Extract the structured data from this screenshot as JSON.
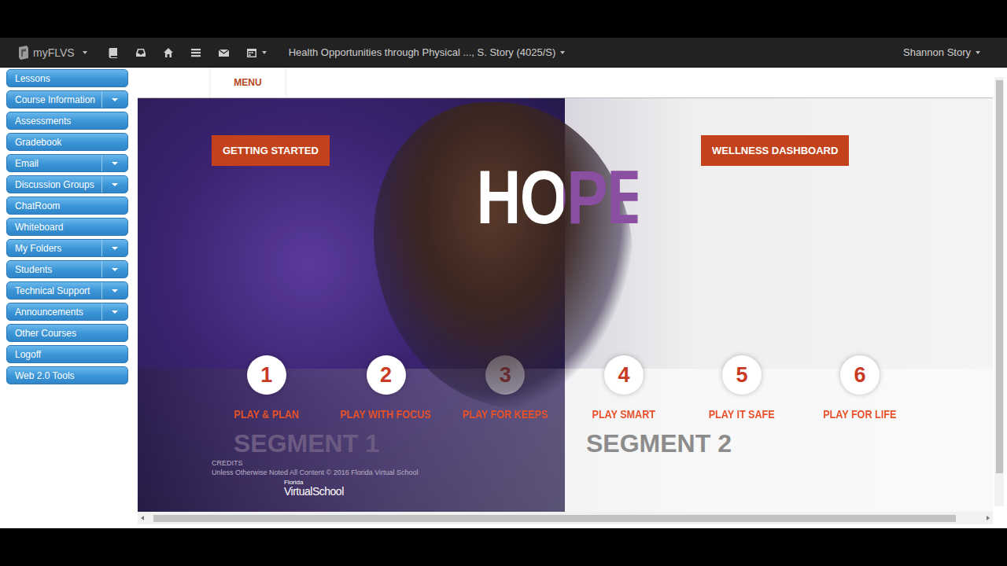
{
  "nav": {
    "logo": "myFLVS",
    "course": "Health Opportunities through Physical ..., S. Story (4025/S)",
    "user": "Shannon Story"
  },
  "sidebar": {
    "items": [
      {
        "label": "Lessons",
        "has_menu": false
      },
      {
        "label": "Course Information",
        "has_menu": true
      },
      {
        "label": "Assessments",
        "has_menu": false
      },
      {
        "label": "Gradebook",
        "has_menu": false
      },
      {
        "label": "Email",
        "has_menu": true
      },
      {
        "label": "Discussion Groups",
        "has_menu": true
      },
      {
        "label": "ChatRoom",
        "has_menu": false
      },
      {
        "label": "Whiteboard",
        "has_menu": false
      },
      {
        "label": "My Folders",
        "has_menu": true
      },
      {
        "label": "Students",
        "has_menu": true
      },
      {
        "label": "Technical Support",
        "has_menu": true
      },
      {
        "label": "Announcements",
        "has_menu": true
      },
      {
        "label": "Other Courses",
        "has_menu": false
      },
      {
        "label": "Logoff",
        "has_menu": false
      },
      {
        "label": "Web 2.0 Tools",
        "has_menu": false
      }
    ]
  },
  "menu_tab": "MENU",
  "hero": {
    "title": "HOPE",
    "segments": [
      {
        "label": "SEGMENT 1",
        "button": "GETTING STARTED",
        "units": [
          {
            "number": "1",
            "label": "PLAY & PLAN"
          },
          {
            "number": "2",
            "label": "PLAY WITH FOCUS"
          },
          {
            "number": "3",
            "label": "PLAY FOR KEEPS"
          }
        ]
      },
      {
        "label": "SEGMENT 2",
        "button": "WELLNESS DASHBOARD",
        "units": [
          {
            "number": "4",
            "label": "PLAY SMART"
          },
          {
            "number": "5",
            "label": "PLAY IT SAFE"
          },
          {
            "number": "6",
            "label": "PLAY FOR LIFE"
          }
        ]
      }
    ],
    "credits": {
      "heading": "CREDITS",
      "text": "Unless Otherwise Noted All Content © 2016 Florida Virtual School",
      "logo_top": "Florida",
      "logo": "VirtualSchool"
    }
  }
}
